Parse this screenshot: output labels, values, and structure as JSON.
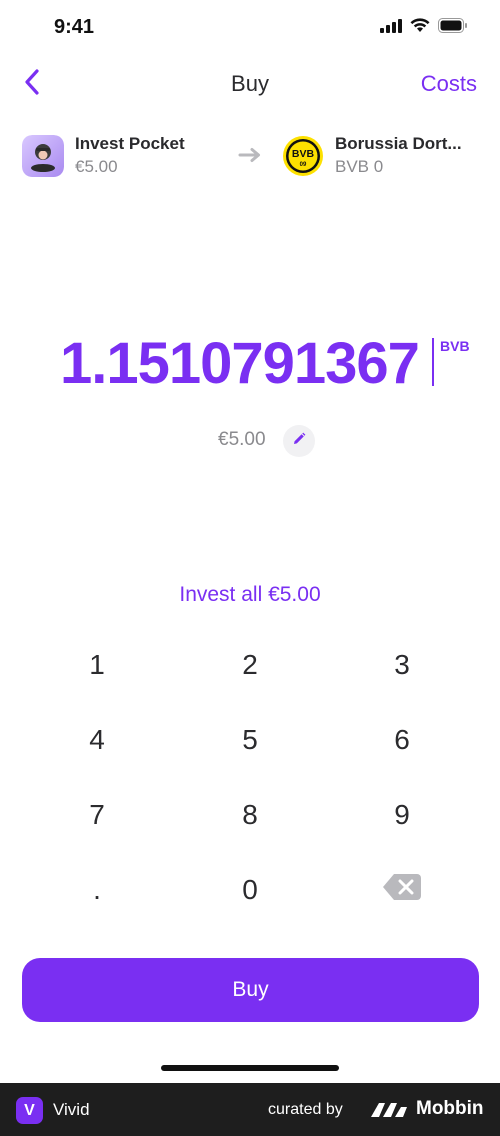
{
  "status_bar": {
    "time": "9:41"
  },
  "nav": {
    "title": "Buy",
    "costs_label": "Costs",
    "back_icon": "chevron-left-icon"
  },
  "from_asset": {
    "name": "Invest Pocket",
    "balance": "€5.00",
    "icon": "invest-pocket-icon"
  },
  "to_asset": {
    "name": "Borussia Dort...",
    "balance": "BVB 0",
    "icon": "bvb-logo-icon"
  },
  "amount": {
    "value": "1.1510791367",
    "unit": "BVB"
  },
  "fiat": {
    "value": "€5.00",
    "edit_icon": "pencil-icon"
  },
  "invest_all_label": "Invest all €5.00",
  "keypad": {
    "keys": [
      "1",
      "2",
      "3",
      "4",
      "5",
      "6",
      "7",
      "8",
      "9",
      ".",
      "0"
    ],
    "delete_icon": "backspace-icon"
  },
  "buy_button": {
    "label": "Buy"
  },
  "footer": {
    "brand": "Vivid",
    "brand_letter": "V",
    "curated": "curated by",
    "source": "Mobbin"
  },
  "colors": {
    "accent": "#7a2ff2",
    "text": "#2b2b2e",
    "muted": "#8a8a8e",
    "bvb_yellow": "#fde100"
  }
}
